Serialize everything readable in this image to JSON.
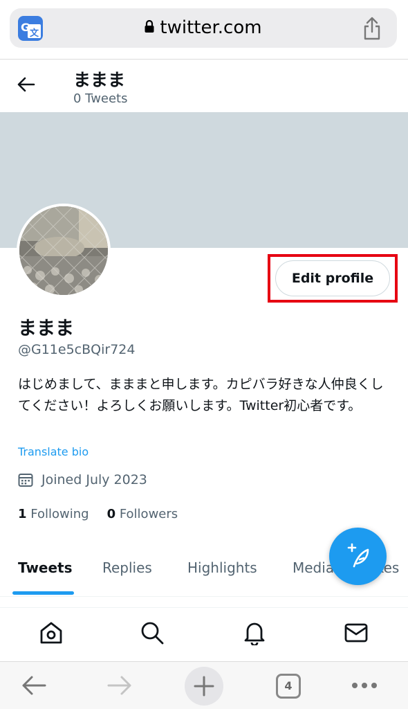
{
  "browser": {
    "url": "twitter.com",
    "icons": [
      "translate-icon",
      "lock-icon",
      "share-icon"
    ]
  },
  "header": {
    "name": "ままま",
    "tweet_count": "0 Tweets"
  },
  "profile": {
    "display_name": "ままま",
    "handle": "@G11e5cBQir724",
    "bio": "はじめまして、まままと申します。カピバラ好きな人仲良くしてください！よろしくお願いします。Twitter初心者です。",
    "translate_bio": "Translate bio",
    "joined": "Joined July 2023",
    "following_count": "1",
    "following_label": "Following",
    "followers_count": "0",
    "followers_label": "Followers",
    "edit_profile": "Edit profile"
  },
  "tabs": [
    "Tweets",
    "Replies",
    "Highlights",
    "Media",
    "Likes"
  ],
  "bottom_nav": [
    "home-icon",
    "search-icon",
    "bell-icon",
    "mail-icon"
  ],
  "browser_toolbar": {
    "tab_count": "4"
  },
  "colors": {
    "accent": "#1d9bf0",
    "banner": "#cfd9de",
    "highlight": "#e60012"
  }
}
